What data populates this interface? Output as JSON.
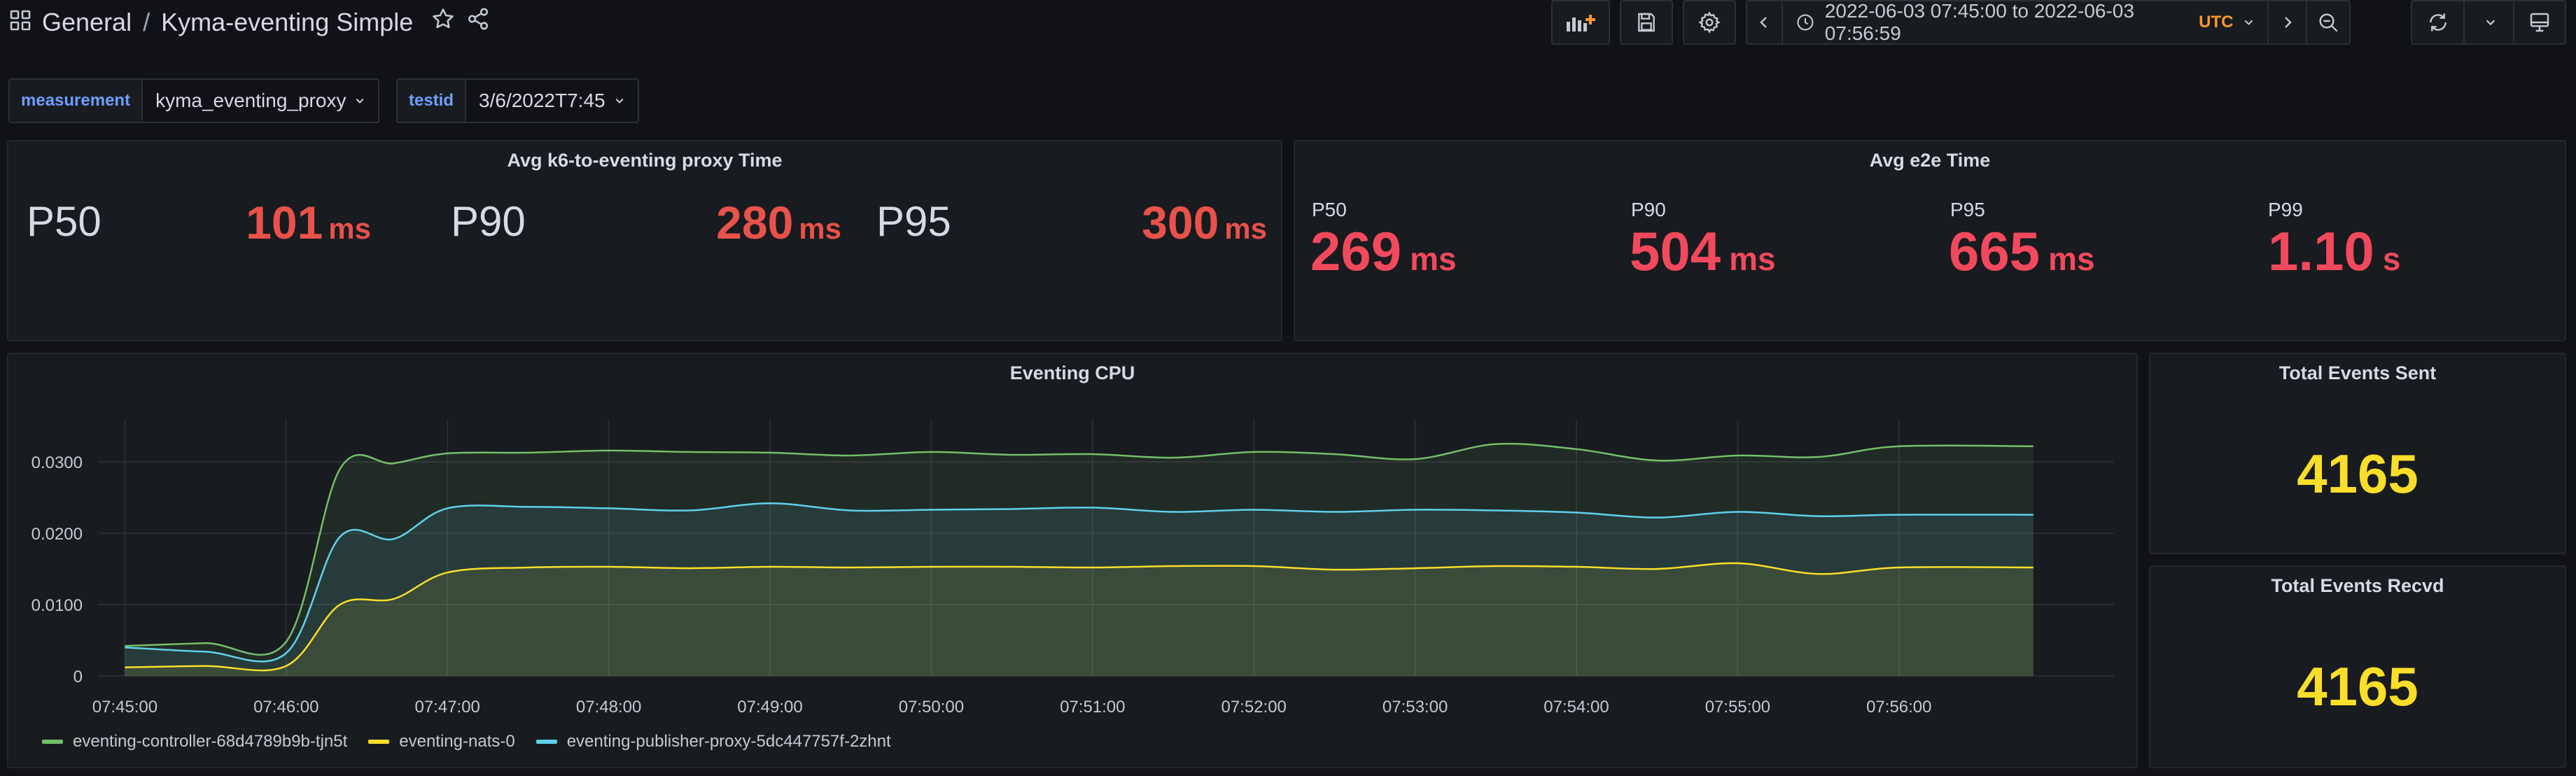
{
  "header": {
    "breadcrumb_folder": "General",
    "breadcrumb_separator": "/",
    "dashboard_title": "Kyma-eventing Simple",
    "time_range": "2022-06-03 07:45:00 to 2022-06-03 07:56:59",
    "timezone": "UTC"
  },
  "variables": [
    {
      "label": "measurement",
      "value": "kyma_eventing_proxy"
    },
    {
      "label": "testid",
      "value": "3/6/2022T7:45"
    }
  ],
  "panel_k6": {
    "title": "Avg k6-to-eventing proxy Time",
    "stats": [
      {
        "label": "P50",
        "value": "101",
        "unit": "ms"
      },
      {
        "label": "P90",
        "value": "280",
        "unit": "ms"
      },
      {
        "label": "P95",
        "value": "300",
        "unit": "ms"
      }
    ]
  },
  "panel_e2e": {
    "title": "Avg e2e Time",
    "stats": [
      {
        "label": "P50",
        "value": "269",
        "unit": "ms"
      },
      {
        "label": "P90",
        "value": "504",
        "unit": "ms"
      },
      {
        "label": "P95",
        "value": "665",
        "unit": "ms"
      },
      {
        "label": "P99",
        "value": "1.10",
        "unit": "s"
      }
    ]
  },
  "panel_sent": {
    "title": "Total Events Sent",
    "value": "4165"
  },
  "panel_recvd": {
    "title": "Total Events Recvd",
    "value": "4165"
  },
  "colors": {
    "controller": "#73bf69",
    "nats": "#fade2a",
    "publisher": "#5fd1ea",
    "stat_red": "#f2495c",
    "stat_yellow": "#fade2a"
  },
  "chart_data": {
    "type": "area",
    "title": "Eventing CPU",
    "xlabel": "",
    "ylabel": "",
    "x": [
      "07:45:00",
      "07:45:30",
      "07:46:00",
      "07:46:20",
      "07:46:40",
      "07:47:00",
      "07:47:30",
      "07:48:00",
      "07:48:30",
      "07:49:00",
      "07:49:30",
      "07:50:00",
      "07:50:30",
      "07:51:00",
      "07:51:30",
      "07:52:00",
      "07:52:30",
      "07:53:00",
      "07:53:30",
      "07:54:00",
      "07:54:30",
      "07:55:00",
      "07:55:30",
      "07:56:00",
      "07:56:50"
    ],
    "x_tick_labels": [
      "07:45:00",
      "07:46:00",
      "07:47:00",
      "07:48:00",
      "07:49:00",
      "07:50:00",
      "07:51:00",
      "07:52:00",
      "07:53:00",
      "07:54:00",
      "07:55:00",
      "07:56:00"
    ],
    "y_tick_labels": [
      "0",
      "0.0100",
      "0.0200",
      "0.0300"
    ],
    "ylim": [
      0,
      0.036
    ],
    "grid": true,
    "legend_position": "bottom-left",
    "series": [
      {
        "name": "eventing-controller-68d4789b9b-tjn5t",
        "color": "#73bf69",
        "values": [
          0.0042,
          0.0046,
          0.0048,
          0.029,
          0.0298,
          0.0312,
          0.0313,
          0.0316,
          0.0314,
          0.0313,
          0.0309,
          0.0314,
          0.031,
          0.0311,
          0.0306,
          0.0314,
          0.0311,
          0.0304,
          0.0325,
          0.0318,
          0.0302,
          0.0309,
          0.0307,
          0.0322,
          0.0322
        ]
      },
      {
        "name": "eventing-nats-0",
        "color": "#fade2a",
        "values": [
          0.0012,
          0.0014,
          0.0014,
          0.01,
          0.0108,
          0.0145,
          0.0152,
          0.0153,
          0.0151,
          0.0153,
          0.0152,
          0.0153,
          0.0153,
          0.0152,
          0.0154,
          0.0154,
          0.0149,
          0.0151,
          0.0154,
          0.0153,
          0.015,
          0.0158,
          0.0143,
          0.0152,
          0.0152
        ]
      },
      {
        "name": "eventing-publisher-proxy-5dc447757f-2zhnt",
        "color": "#5fd1ea",
        "values": [
          0.004,
          0.0034,
          0.0032,
          0.0195,
          0.0192,
          0.0235,
          0.0237,
          0.0235,
          0.0232,
          0.0242,
          0.0232,
          0.0233,
          0.0234,
          0.0236,
          0.023,
          0.0233,
          0.023,
          0.0233,
          0.0232,
          0.0229,
          0.0222,
          0.023,
          0.0224,
          0.0226,
          0.0226
        ]
      }
    ]
  }
}
